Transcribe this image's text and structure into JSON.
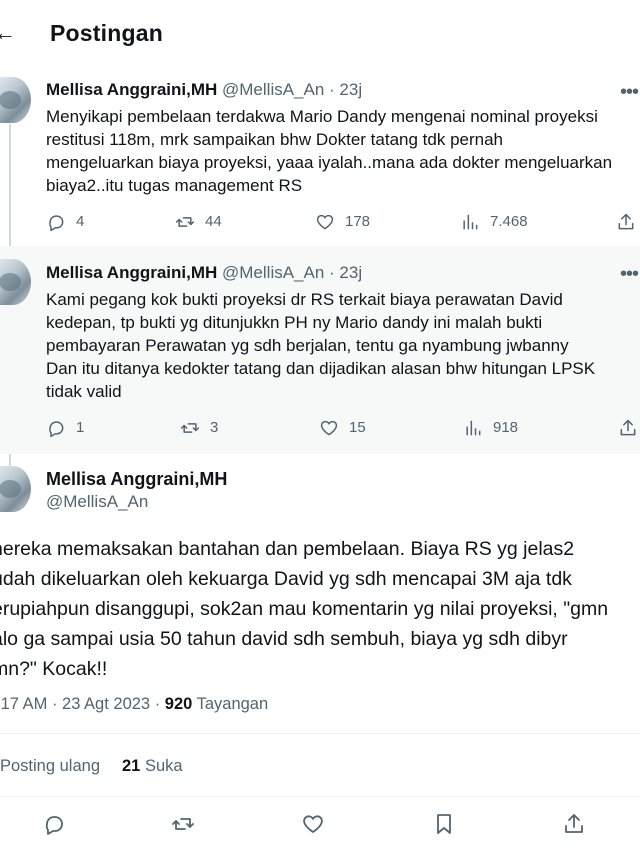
{
  "header": {
    "back_glyph": "←",
    "title": "Postingan"
  },
  "tweets": [
    {
      "name": "Mellisa Anggraini,MH",
      "handle_time": "@MellisA_An · 23j",
      "lines": [
        "Menyikapi pembelaan terdakwa Mario Dandy mengenai nominal proyeksi",
        "restitusi 118m, mrk sampaikan bhw Dokter tatang tdk pernah",
        "mengeluarkan biaya proyeksi, yaaa iyalah..mana ada dokter mengeluarkan",
        "biaya2..itu tugas management RS"
      ],
      "replies": "4",
      "reposts": "44",
      "likes": "178",
      "views": "7.468"
    },
    {
      "name": "Mellisa Anggraini,MH",
      "handle_time": "@MellisA_An · 23j",
      "lines": [
        "Kami pegang kok bukti proyeksi dr RS terkait biaya perawatan David",
        "kedepan, tp bukti yg ditunjukkn PH ny Mario dandy ini malah bukti",
        "pembayaran Perawatan yg sdh berjalan, tentu ga nyambung jwbanny",
        "Dan itu ditanya kedokter tatang dan dijadikan alasan bhw hitungan LPSK",
        "tidak valid"
      ],
      "replies": "1",
      "reposts": "3",
      "likes": "15",
      "views": "918"
    }
  ],
  "main": {
    "name": "Mellisa Anggraini,MH",
    "handle": "@MellisA_An",
    "lines": [
      "nereka memaksakan bantahan dan pembelaan. Biaya RS yg jelas2",
      "udah dikeluarkan oleh kekuarga David yg sdh mencapai 3M aja tdk",
      "erupiahpun disanggupi, sok2an mau komentarin yg nilai proyeksi, \"gmn",
      "alo ga sampai usia 50 tahun david sdh sembuh, biaya yg sdh dibyr",
      "mn?\" Kocak!!"
    ],
    "time_date": ".17 AM · 23 Agt 2023 · ",
    "views_count": "920",
    "views_label": " Tayangan",
    "reposts_label": "Posting ulang",
    "likes_count": "21",
    "likes_label": " Suka"
  },
  "icons": [
    "more-icon",
    "reply-icon",
    "repost-icon",
    "like-icon",
    "views-icon",
    "share-icon",
    "bookmark-icon"
  ]
}
